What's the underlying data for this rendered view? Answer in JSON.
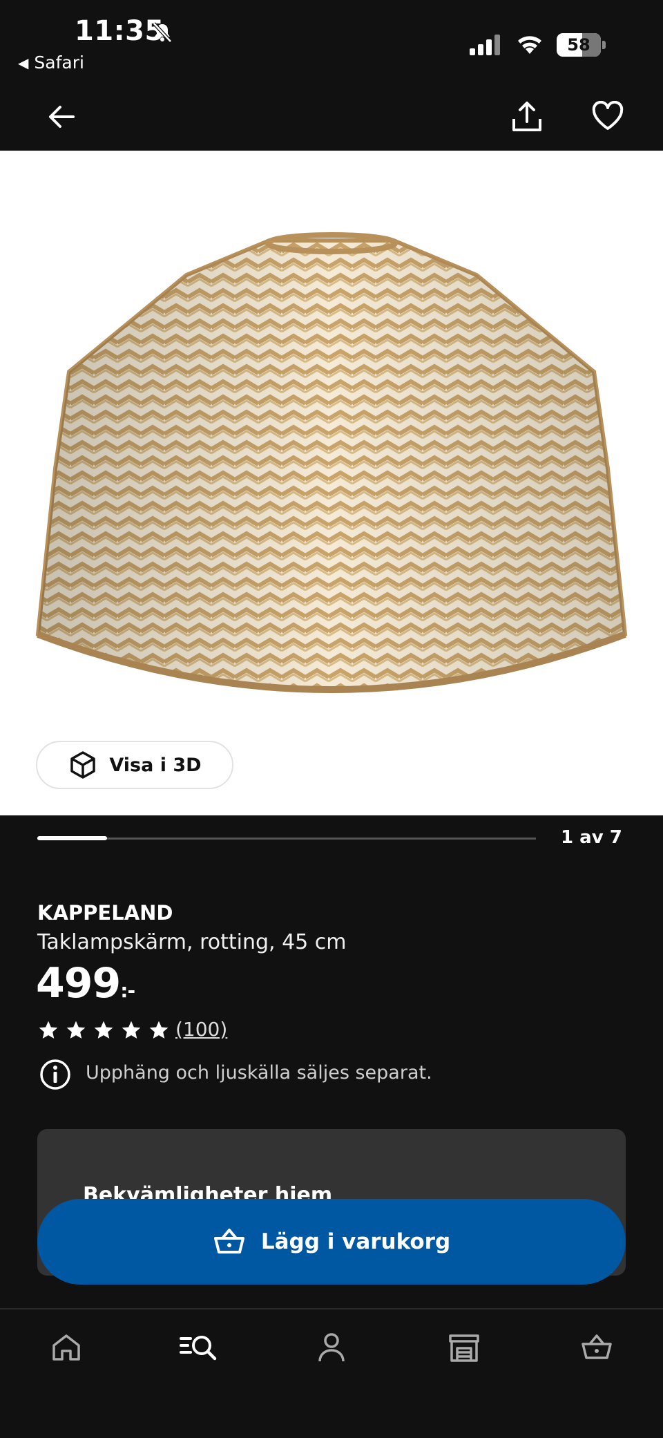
{
  "status_bar": {
    "time": "11:35",
    "back_app": "Safari",
    "battery": "58"
  },
  "nav": {
    "back_icon": "arrow-left-icon",
    "share_icon": "share-icon",
    "favorite_icon": "heart-icon"
  },
  "gallery": {
    "view_3d_label": "Visa i 3D",
    "position_label": "1 av 7",
    "progress": 0.14
  },
  "product": {
    "brand": "KAPPELAND",
    "description": "Taklampskärm, rotting, 45 cm",
    "price": "499",
    "price_suffix": ":-",
    "rating_stars": 5,
    "review_count": "(100)",
    "note": "Upphäng och ljuskälla säljes separat."
  },
  "card": {
    "partial_text": "Bekvämligheter hjem"
  },
  "actions": {
    "add_to_cart_label": "Lägg i varukorg"
  },
  "tabs": [
    {
      "name": "home",
      "icon": "home-icon"
    },
    {
      "name": "search",
      "icon": "search-icon"
    },
    {
      "name": "profile",
      "icon": "person-icon"
    },
    {
      "name": "stores",
      "icon": "store-icon"
    },
    {
      "name": "cart",
      "icon": "basket-icon"
    }
  ],
  "colors": {
    "background": "#111111",
    "accent": "#0058a3",
    "card": "#333333"
  }
}
